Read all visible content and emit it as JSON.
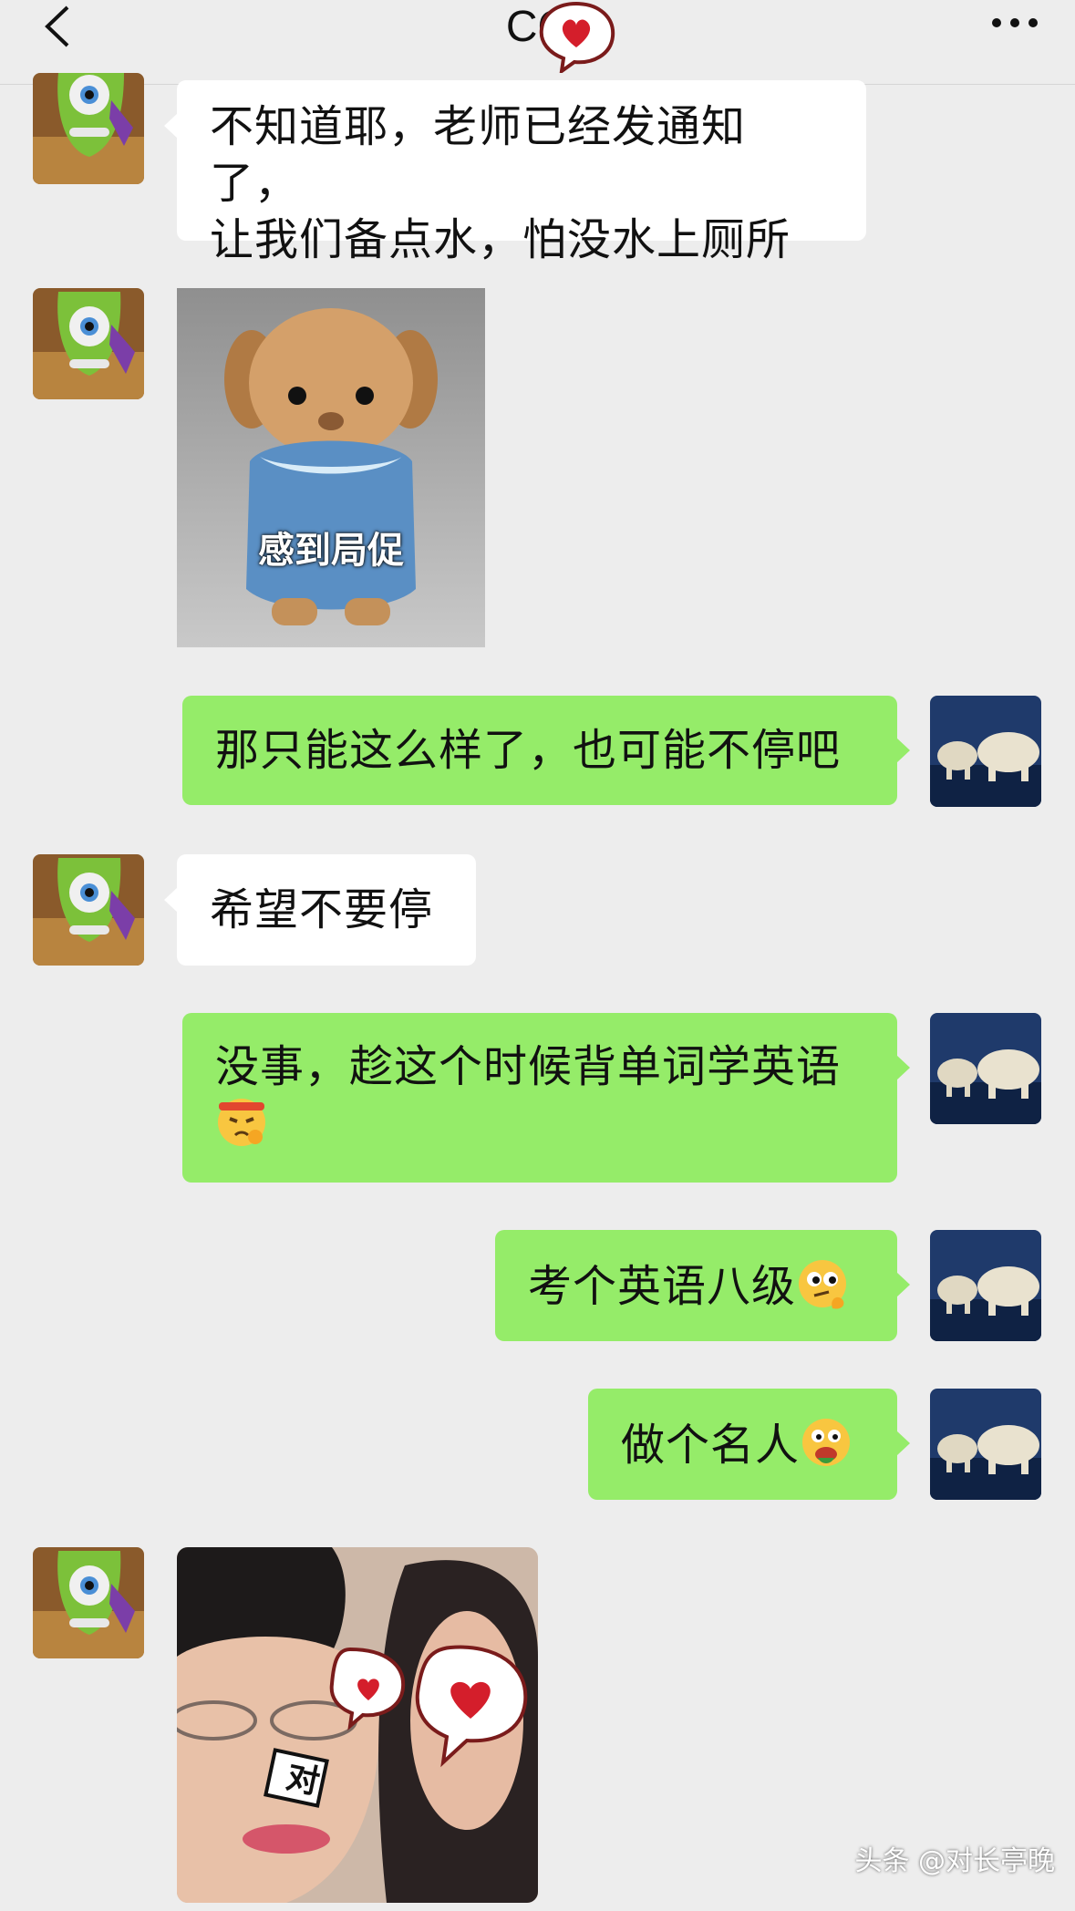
{
  "header": {
    "title": "CC",
    "back_icon": "chevron-left-icon",
    "more_icon": "more-dots-icon"
  },
  "messages": [
    {
      "side": "in",
      "type": "text",
      "lines": [
        "不知道耶，老师已经发通知了，",
        "让我们备点水，怕没水上厕所"
      ]
    },
    {
      "side": "in",
      "type": "sticker",
      "caption": "感到局促"
    },
    {
      "side": "out",
      "type": "text",
      "lines": [
        "那只能这么样了，也可能不停吧"
      ]
    },
    {
      "side": "in",
      "type": "text",
      "lines": [
        "希望不要停"
      ]
    },
    {
      "side": "out",
      "type": "text",
      "lines": [
        "没事，趁这个时候背单词学英语"
      ],
      "emoji": "determined-face-emoji"
    },
    {
      "side": "out",
      "type": "text",
      "lines": [
        "考个英语八级"
      ],
      "emoji": "thinking-face-emoji"
    },
    {
      "side": "out",
      "type": "text",
      "lines": [
        "做个名人"
      ],
      "emoji": "eating-face-emoji"
    },
    {
      "side": "in",
      "type": "photo",
      "sticker_text": "对"
    }
  ],
  "watermark": "头条 @对长亭晚",
  "colors": {
    "background": "#ededed",
    "out_bubble": "#95ec69",
    "in_bubble": "#ffffff"
  }
}
